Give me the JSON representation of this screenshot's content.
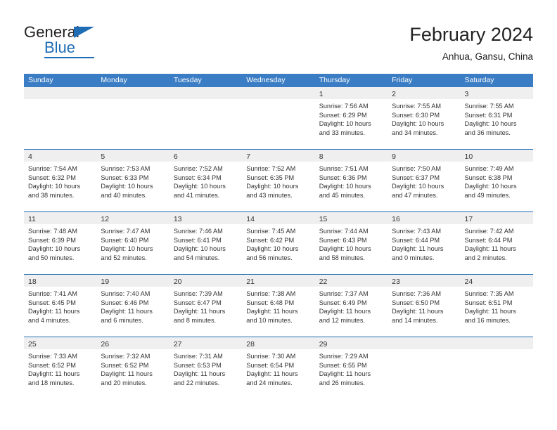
{
  "brand": {
    "name_part1": "General",
    "name_part2": "Blue",
    "accent_color": "#1f6db5"
  },
  "header": {
    "title": "February 2024",
    "subtitle": "Anhua, Gansu, China"
  },
  "calendar": {
    "header_bg": "#3b7dc4",
    "day_band_bg": "#efefef",
    "row_border_color": "#1f6db5",
    "weekdays": [
      "Sunday",
      "Monday",
      "Tuesday",
      "Wednesday",
      "Thursday",
      "Friday",
      "Saturday"
    ],
    "weeks": [
      [
        {
          "day": "",
          "lines": []
        },
        {
          "day": "",
          "lines": []
        },
        {
          "day": "",
          "lines": []
        },
        {
          "day": "",
          "lines": []
        },
        {
          "day": "1",
          "lines": [
            "Sunrise: 7:56 AM",
            "Sunset: 6:29 PM",
            "Daylight: 10 hours",
            "and 33 minutes."
          ]
        },
        {
          "day": "2",
          "lines": [
            "Sunrise: 7:55 AM",
            "Sunset: 6:30 PM",
            "Daylight: 10 hours",
            "and 34 minutes."
          ]
        },
        {
          "day": "3",
          "lines": [
            "Sunrise: 7:55 AM",
            "Sunset: 6:31 PM",
            "Daylight: 10 hours",
            "and 36 minutes."
          ]
        }
      ],
      [
        {
          "day": "4",
          "lines": [
            "Sunrise: 7:54 AM",
            "Sunset: 6:32 PM",
            "Daylight: 10 hours",
            "and 38 minutes."
          ]
        },
        {
          "day": "5",
          "lines": [
            "Sunrise: 7:53 AM",
            "Sunset: 6:33 PM",
            "Daylight: 10 hours",
            "and 40 minutes."
          ]
        },
        {
          "day": "6",
          "lines": [
            "Sunrise: 7:52 AM",
            "Sunset: 6:34 PM",
            "Daylight: 10 hours",
            "and 41 minutes."
          ]
        },
        {
          "day": "7",
          "lines": [
            "Sunrise: 7:52 AM",
            "Sunset: 6:35 PM",
            "Daylight: 10 hours",
            "and 43 minutes."
          ]
        },
        {
          "day": "8",
          "lines": [
            "Sunrise: 7:51 AM",
            "Sunset: 6:36 PM",
            "Daylight: 10 hours",
            "and 45 minutes."
          ]
        },
        {
          "day": "9",
          "lines": [
            "Sunrise: 7:50 AM",
            "Sunset: 6:37 PM",
            "Daylight: 10 hours",
            "and 47 minutes."
          ]
        },
        {
          "day": "10",
          "lines": [
            "Sunrise: 7:49 AM",
            "Sunset: 6:38 PM",
            "Daylight: 10 hours",
            "and 49 minutes."
          ]
        }
      ],
      [
        {
          "day": "11",
          "lines": [
            "Sunrise: 7:48 AM",
            "Sunset: 6:39 PM",
            "Daylight: 10 hours",
            "and 50 minutes."
          ]
        },
        {
          "day": "12",
          "lines": [
            "Sunrise: 7:47 AM",
            "Sunset: 6:40 PM",
            "Daylight: 10 hours",
            "and 52 minutes."
          ]
        },
        {
          "day": "13",
          "lines": [
            "Sunrise: 7:46 AM",
            "Sunset: 6:41 PM",
            "Daylight: 10 hours",
            "and 54 minutes."
          ]
        },
        {
          "day": "14",
          "lines": [
            "Sunrise: 7:45 AM",
            "Sunset: 6:42 PM",
            "Daylight: 10 hours",
            "and 56 minutes."
          ]
        },
        {
          "day": "15",
          "lines": [
            "Sunrise: 7:44 AM",
            "Sunset: 6:43 PM",
            "Daylight: 10 hours",
            "and 58 minutes."
          ]
        },
        {
          "day": "16",
          "lines": [
            "Sunrise: 7:43 AM",
            "Sunset: 6:44 PM",
            "Daylight: 11 hours",
            "and 0 minutes."
          ]
        },
        {
          "day": "17",
          "lines": [
            "Sunrise: 7:42 AM",
            "Sunset: 6:44 PM",
            "Daylight: 11 hours",
            "and 2 minutes."
          ]
        }
      ],
      [
        {
          "day": "18",
          "lines": [
            "Sunrise: 7:41 AM",
            "Sunset: 6:45 PM",
            "Daylight: 11 hours",
            "and 4 minutes."
          ]
        },
        {
          "day": "19",
          "lines": [
            "Sunrise: 7:40 AM",
            "Sunset: 6:46 PM",
            "Daylight: 11 hours",
            "and 6 minutes."
          ]
        },
        {
          "day": "20",
          "lines": [
            "Sunrise: 7:39 AM",
            "Sunset: 6:47 PM",
            "Daylight: 11 hours",
            "and 8 minutes."
          ]
        },
        {
          "day": "21",
          "lines": [
            "Sunrise: 7:38 AM",
            "Sunset: 6:48 PM",
            "Daylight: 11 hours",
            "and 10 minutes."
          ]
        },
        {
          "day": "22",
          "lines": [
            "Sunrise: 7:37 AM",
            "Sunset: 6:49 PM",
            "Daylight: 11 hours",
            "and 12 minutes."
          ]
        },
        {
          "day": "23",
          "lines": [
            "Sunrise: 7:36 AM",
            "Sunset: 6:50 PM",
            "Daylight: 11 hours",
            "and 14 minutes."
          ]
        },
        {
          "day": "24",
          "lines": [
            "Sunrise: 7:35 AM",
            "Sunset: 6:51 PM",
            "Daylight: 11 hours",
            "and 16 minutes."
          ]
        }
      ],
      [
        {
          "day": "25",
          "lines": [
            "Sunrise: 7:33 AM",
            "Sunset: 6:52 PM",
            "Daylight: 11 hours",
            "and 18 minutes."
          ]
        },
        {
          "day": "26",
          "lines": [
            "Sunrise: 7:32 AM",
            "Sunset: 6:52 PM",
            "Daylight: 11 hours",
            "and 20 minutes."
          ]
        },
        {
          "day": "27",
          "lines": [
            "Sunrise: 7:31 AM",
            "Sunset: 6:53 PM",
            "Daylight: 11 hours",
            "and 22 minutes."
          ]
        },
        {
          "day": "28",
          "lines": [
            "Sunrise: 7:30 AM",
            "Sunset: 6:54 PM",
            "Daylight: 11 hours",
            "and 24 minutes."
          ]
        },
        {
          "day": "29",
          "lines": [
            "Sunrise: 7:29 AM",
            "Sunset: 6:55 PM",
            "Daylight: 11 hours",
            "and 26 minutes."
          ]
        },
        {
          "day": "",
          "lines": []
        },
        {
          "day": "",
          "lines": []
        }
      ]
    ]
  }
}
